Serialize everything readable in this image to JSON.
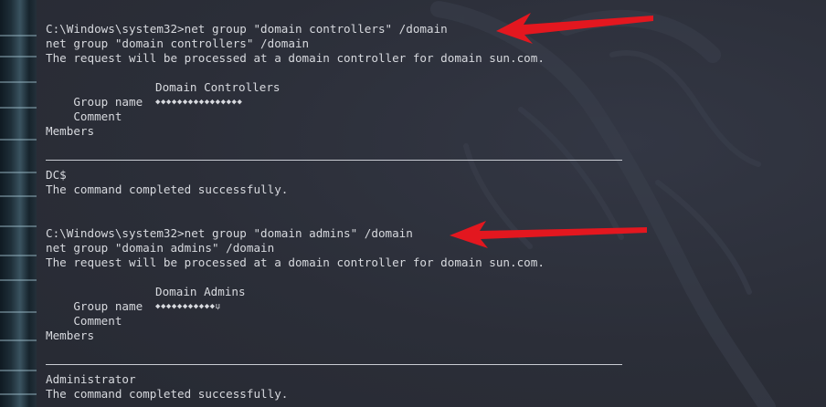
{
  "terminal": {
    "block1": {
      "prompt_line": "C:\\Windows\\system32>net group \"domain controllers\" /domain",
      "echo_line": "net group \"domain controllers\" /domain",
      "request_line": "The request will be processed at a domain controller for domain sun.com.",
      "group_name_label": "Group name",
      "group_name_value": "Domain Controllers",
      "comment_label": "Comment",
      "comment_value": "◆◆◆◆◆◆◆◆◆◆◆◆◆◆◆◆",
      "members_label": "Members",
      "member": "DC$",
      "completed_line": "The command completed successfully."
    },
    "block2": {
      "prompt_line": "C:\\Windows\\system32>net group \"domain admins\" /domain",
      "echo_line": "net group \"domain admins\" /domain",
      "request_line": "The request will be processed at a domain controller for domain sun.com.",
      "group_name_label": "Group name",
      "group_name_value": "Domain Admins",
      "comment_label": "Comment",
      "comment_value": "◆◆◆◆◆◆◆◆◆◆◆џ",
      "members_label": "Members",
      "member": "Administrator",
      "completed_line": "The command completed successfully."
    }
  },
  "colors": {
    "background": "#2b2e38",
    "text": "#d7d9de",
    "arrow": "#e3171f"
  },
  "icons": {
    "watermark": "kali-dragon-watermark",
    "annotation": "red-arrow-icon"
  }
}
